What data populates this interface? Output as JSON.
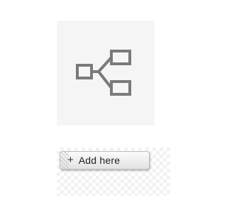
{
  "tile": {
    "icon": "hierarchy-branch-icon",
    "icon_color": "#7a7a7a",
    "background": "#f5f5f5"
  },
  "add_button": {
    "icon": "plus-icon",
    "plus_glyph": "+",
    "label": "Add here"
  }
}
